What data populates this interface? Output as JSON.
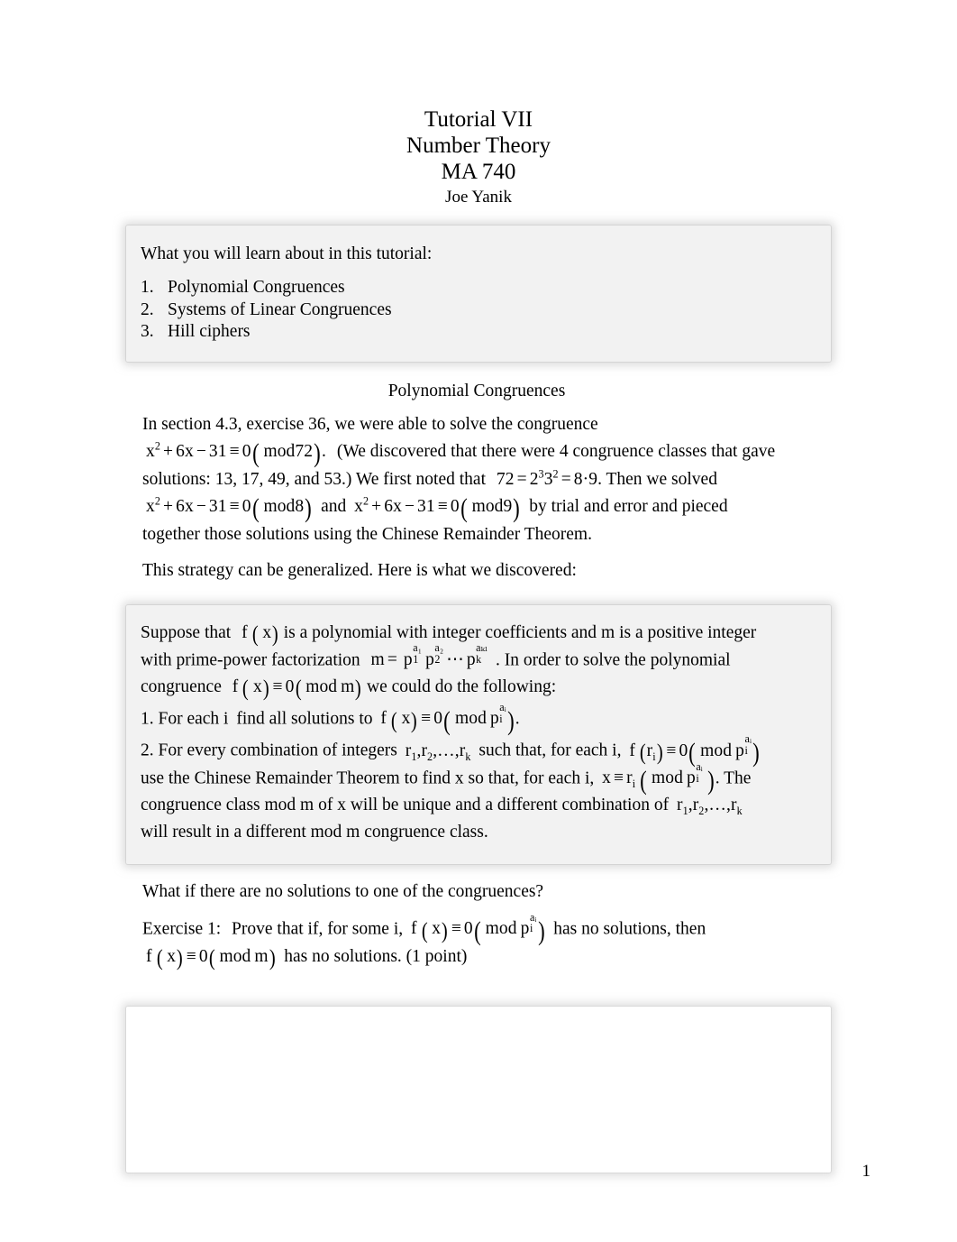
{
  "document": {
    "title_lines": [
      "Tutorial VII",
      "Number Theory",
      "MA 740"
    ],
    "author": "Joe Yanik",
    "page_number": "1"
  },
  "objectives_box": {
    "lead_in": "What you will learn about in this tutorial:",
    "items": [
      {
        "number": "1.",
        "label": "Polynomial Congruences"
      },
      {
        "number": "2.",
        "label": "Systems of Linear Congruences"
      },
      {
        "number": "3.",
        "label": "Hill ciphers"
      }
    ]
  },
  "section": {
    "heading": "Polynomial Congruences",
    "paragraph_1": {
      "line_1": "In section 4.3, exercise 36, we were able to solve the congruence",
      "math_1": "x² + 6x − 31 ≡ 0 (mod 72).",
      "after_math_1": "(We discovered that there were 4 congruence classes that gave",
      "line_2_a": "solutions: 13, 17, 49, and 53.) We first noted that",
      "math_2": "72 = 2³3² = 8·9",
      "line_2_b": ". Then we solved",
      "math_3": "x² + 6x − 31 ≡ 0 (mod 8)",
      "joiner": "and",
      "math_4": "x² + 6x − 31 ≡ 0 (mod 9)",
      "line_3_b": "by trial and error and pieced",
      "line_4": "together those solutions using the Chinese Remainder Theorem."
    },
    "paragraph_2": "This strategy can be generalized. Here is what we discovered:"
  },
  "theory_box": {
    "line_1_a": "Suppose that",
    "line_1_math": "f (x)",
    "line_1_b": "is a polynomial with integer coefficients and",
    "line_1_m": "m",
    "line_1_c": "is a positive integer",
    "line_2_a": "with prime-power factorization",
    "line_2_math": "m = p₁^a₁ p₂^a₂ ⋯ pₖ^aₖₗ",
    "line_2_b": ". In order to solve the polynomial",
    "line_3_a": "congruence",
    "line_3_math": "f (x) ≡ 0 (mod m)",
    "line_3_b": "we could do the following:",
    "step_1": {
      "number": "1.",
      "text_a": "For each i",
      "text_b": "find all solutions to",
      "math": "f (x) ≡ 0 (mod pᵢ^aᵢ)",
      "text_c": "."
    },
    "step_2": {
      "number": "2.",
      "text_a": "For every combination of integers",
      "math_a": "r₁, r₂, …, rₖ",
      "text_b": "such that, for each i,",
      "math_b": "f (rᵢ) ≡ 0 (mod pᵢ^aᵢ)",
      "text_c": "use the Chinese Remainder Theorem to find x so that, for each i,",
      "math_c": "x ≡ rᵢ (mod pᵢ^aᵢ)",
      "text_d": ". The",
      "text_e": "congruence class mod m of x will be unique and a different combination of",
      "math_d": "r₁, r₂, …, rₖ",
      "text_f": "will result in a different mod m congruence class."
    }
  },
  "exercise_section": {
    "question": "What if there are no solutions to one of the congruences?",
    "exercise_label": "Exercise 1:",
    "exercise_text_a": "Prove that if, for some i,",
    "exercise_math_a": "f (x) ≡ 0 (mod pᵢ^aᵢ)",
    "exercise_text_b": "has no solutions, then",
    "exercise_math_b": "f (x) ≡ 0 (mod m)",
    "exercise_text_c": "has no solutions. (1 point)",
    "answer_box_content": ""
  }
}
